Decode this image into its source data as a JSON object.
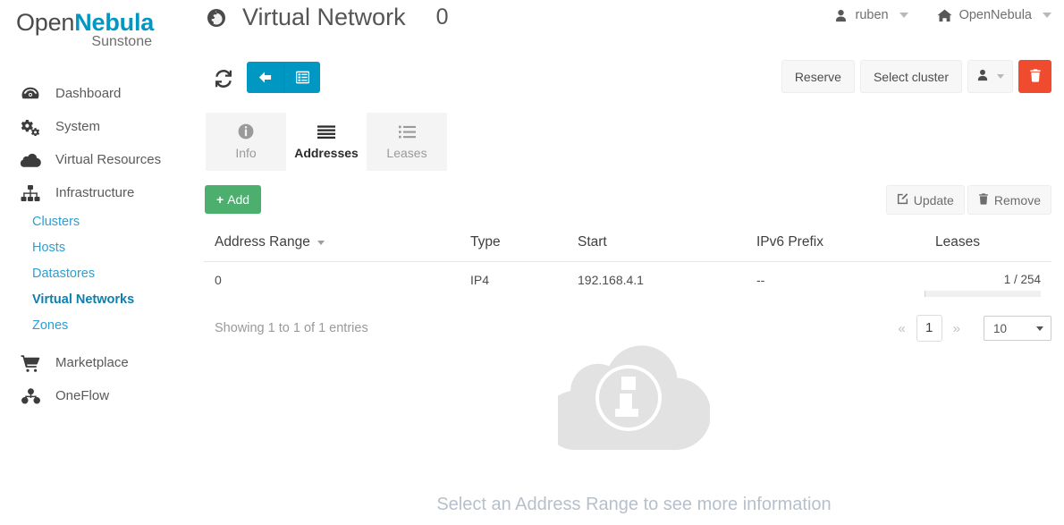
{
  "brand": {
    "open": "Open",
    "nebula": "Nebula",
    "sub": "Sunstone"
  },
  "sidebar": {
    "items": [
      {
        "label": "Dashboard",
        "icon": "dashboard-icon"
      },
      {
        "label": "System",
        "icon": "gears-icon"
      },
      {
        "label": "Virtual Resources",
        "icon": "cloud-icon"
      },
      {
        "label": "Infrastructure",
        "icon": "sitemap-icon"
      }
    ],
    "sub_items": [
      {
        "label": "Clusters",
        "active": false
      },
      {
        "label": "Hosts",
        "active": false
      },
      {
        "label": "Datastores",
        "active": false
      },
      {
        "label": "Virtual Networks",
        "active": true
      },
      {
        "label": "Zones",
        "active": false
      }
    ],
    "items_bottom": [
      {
        "label": "Marketplace",
        "icon": "shopping-cart-icon"
      },
      {
        "label": "OneFlow",
        "icon": "oneflow-icon"
      }
    ]
  },
  "header": {
    "title": "Virtual Network",
    "resource_id": "0",
    "user": "ruben",
    "zone": "OpenNebula"
  },
  "toolbar": {
    "reserve_label": "Reserve",
    "select_cluster_label": "Select cluster"
  },
  "tabs": [
    {
      "label": "Info",
      "icon": "info-circle-icon",
      "active": false
    },
    {
      "label": "Addresses",
      "icon": "align-justify-icon",
      "active": true
    },
    {
      "label": "Leases",
      "icon": "list-ul-icon",
      "active": false
    }
  ],
  "table_actions": {
    "add_label": "Add",
    "update_label": "Update",
    "remove_label": "Remove"
  },
  "table": {
    "columns": [
      "Address Range",
      "Type",
      "Start",
      "IPv6 Prefix",
      "Leases"
    ],
    "rows": [
      {
        "address_range": "0",
        "type": "IP4",
        "start": "192.168.4.1",
        "ipv6_prefix": "--",
        "leases_text": "1 / 254",
        "leases_percent": 0.4
      }
    ],
    "showing": "Showing 1 to 1 of 1 entries"
  },
  "pagination": {
    "prev": "«",
    "page": "1",
    "next": "»",
    "page_size": "10"
  },
  "placeholder": {
    "text": "Select an Address Range to see more information"
  },
  "colors": {
    "accent_cyan": "#0098c3",
    "add_green": "#4caf6e",
    "danger_red": "#ef4b2f",
    "link_blue": "#2c9fd4",
    "active_blue": "#0c7fae"
  }
}
